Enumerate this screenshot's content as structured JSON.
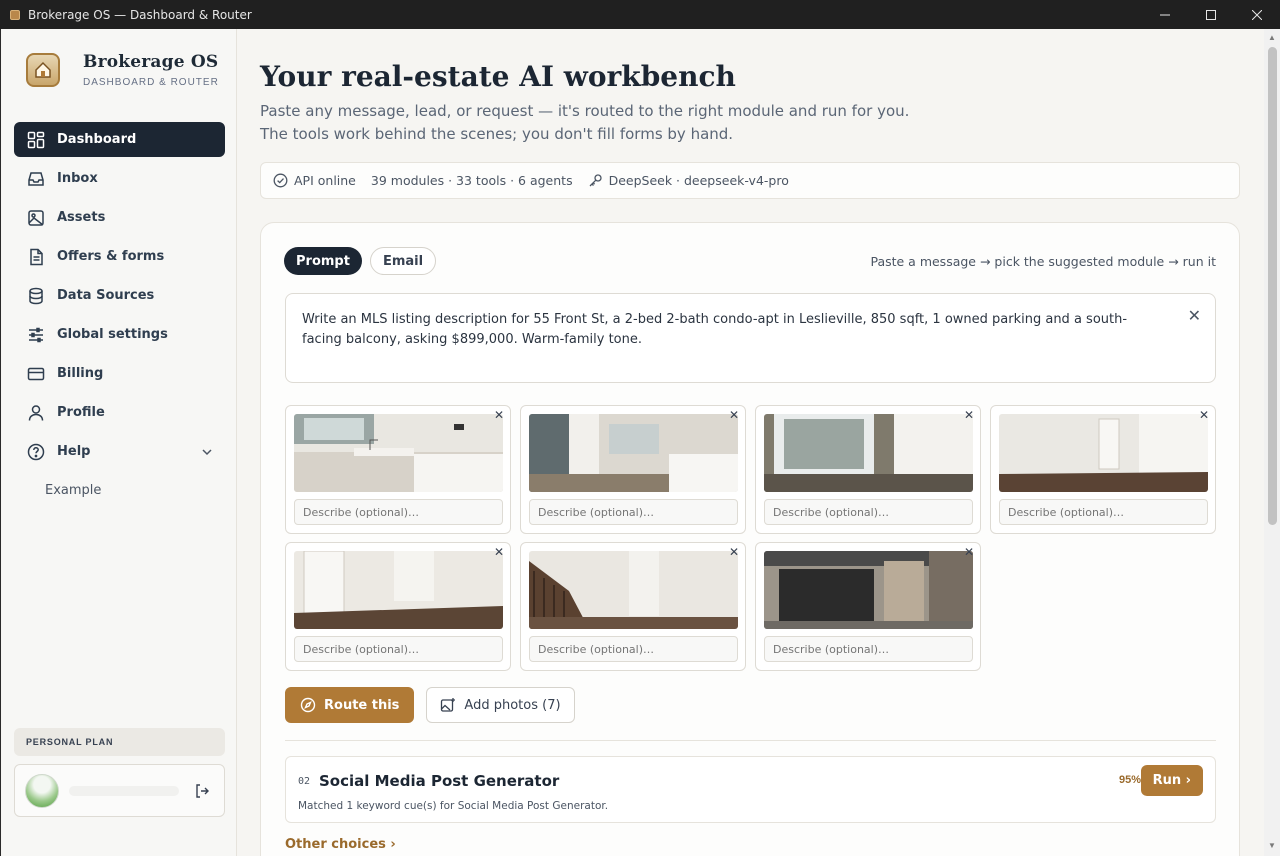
{
  "window": {
    "title": "Brokerage OS — Dashboard & Router"
  },
  "brand": {
    "title": "Brokerage OS",
    "subtitle": "DASHBOARD & ROUTER"
  },
  "nav": {
    "items": [
      {
        "label": "Dashboard",
        "icon": "dashboard-grid-icon",
        "active": true
      },
      {
        "label": "Inbox",
        "icon": "inbox-icon"
      },
      {
        "label": "Assets",
        "icon": "image-icon"
      },
      {
        "label": "Offers & forms",
        "icon": "document-icon"
      },
      {
        "label": "Data Sources",
        "icon": "database-icon"
      },
      {
        "label": "Global settings",
        "icon": "sliders-icon"
      },
      {
        "label": "Billing",
        "icon": "credit-card-icon"
      },
      {
        "label": "Profile",
        "icon": "user-icon"
      },
      {
        "label": "Help",
        "icon": "help-circle-icon"
      }
    ],
    "help_sub": {
      "label": "Example"
    }
  },
  "plan": {
    "label": "PERSONAL PLAN"
  },
  "main": {
    "title": "Your real-estate AI workbench",
    "lead": "Paste any message, lead, or request — it's routed to the right module and run for you. The tools work behind the scenes; you don't fill forms by hand."
  },
  "status": {
    "api": "API online",
    "counts": "39 modules · 33 tools · 6 agents",
    "model": "DeepSeek · deepseek-v4-pro"
  },
  "panel": {
    "tabs": [
      {
        "label": "Prompt",
        "active": true
      },
      {
        "label": "Email",
        "active": false
      }
    ],
    "hint": "Paste a message → pick the suggested module → run it",
    "prompt_text": "Write an MLS listing description for 55 Front St, a 2-bed 2-bath condo-apt in Leslieville, 850 sqft, 1 owned parking and a south-facing balcony, asking $899,000. Warm-family tone.",
    "photo_placeholder": "Describe (optional)…",
    "photos": [
      {
        "scene": "kitchen"
      },
      {
        "scene": "kitchen-island"
      },
      {
        "scene": "window-room"
      },
      {
        "scene": "empty-room"
      },
      {
        "scene": "hallway-door"
      },
      {
        "scene": "staircase"
      },
      {
        "scene": "garage-exterior"
      }
    ],
    "route_label": "Route this",
    "add_photos_label": "Add photos (7)",
    "result": {
      "number": "02",
      "title": "Social Media Post Generator",
      "subtitle": "Matched 1 keyword cue(s) for Social Media Post Generator.",
      "confidence": "95%",
      "run_label": "Run ›"
    },
    "other_choices": "Other choices ›"
  }
}
